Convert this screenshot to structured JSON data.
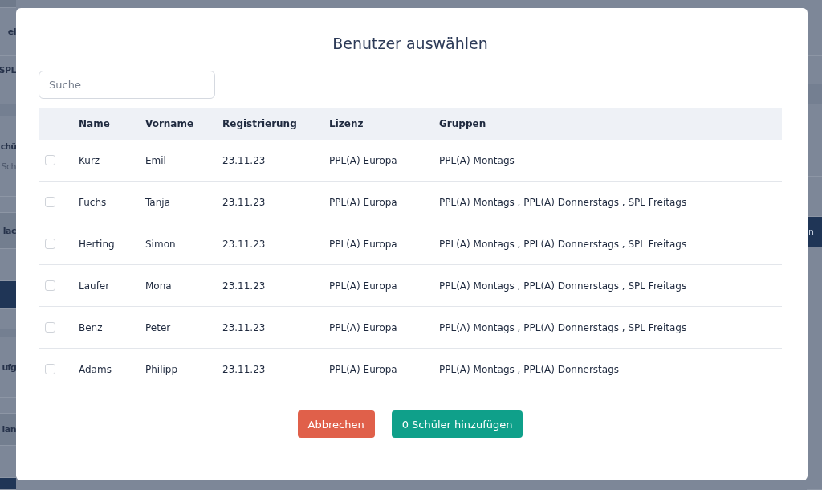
{
  "background": {
    "left_fragments": [
      {
        "text": "el",
        "kind": "label"
      },
      {
        "text": "SPL",
        "kind": "label"
      },
      {
        "text": "chü",
        "kind": "heading"
      },
      {
        "text": "Sch",
        "kind": "muted"
      },
      {
        "text": "lac",
        "kind": "label"
      },
      {
        "text": "ufg",
        "kind": "heading"
      },
      {
        "text": "lan",
        "kind": "label"
      }
    ],
    "right_fragments": [
      {
        "text": "n",
        "kind": "button"
      }
    ]
  },
  "dialog": {
    "title": "Benutzer auswählen",
    "search": {
      "placeholder": "Suche"
    },
    "table": {
      "columns": [
        "Name",
        "Vorname",
        "Registrierung",
        "Lizenz",
        "Gruppen"
      ],
      "rows": [
        {
          "checked": false,
          "cells": [
            "Kurz",
            "Emil",
            "23.11.23",
            "PPL(A) Europa",
            "PPL(A) Montags"
          ]
        },
        {
          "checked": false,
          "cells": [
            "Fuchs",
            "Tanja",
            "23.11.23",
            "PPL(A) Europa",
            "PPL(A) Montags , PPL(A) Donnerstags , SPL Freitags"
          ]
        },
        {
          "checked": false,
          "cells": [
            "Herting",
            "Simon",
            "23.11.23",
            "PPL(A) Europa",
            "PPL(A) Montags , PPL(A) Donnerstags , SPL Freitags"
          ]
        },
        {
          "checked": false,
          "cells": [
            "Laufer",
            "Mona",
            "23.11.23",
            "PPL(A) Europa",
            "PPL(A) Montags , PPL(A) Donnerstags , SPL Freitags"
          ]
        },
        {
          "checked": false,
          "cells": [
            "Benz",
            "Peter",
            "23.11.23",
            "PPL(A) Europa",
            "PPL(A) Montags , PPL(A) Donnerstags , SPL Freitags"
          ]
        },
        {
          "checked": false,
          "cells": [
            "Adams",
            "Philipp",
            "23.11.23",
            "PPL(A) Europa",
            "PPL(A) Montags , PPL(A) Donnerstags"
          ]
        }
      ]
    },
    "buttons": [
      {
        "label": "Abbrechen",
        "kind": "cancel"
      },
      {
        "label": "0 Schüler hinzufügen",
        "kind": "primary"
      }
    ]
  }
}
